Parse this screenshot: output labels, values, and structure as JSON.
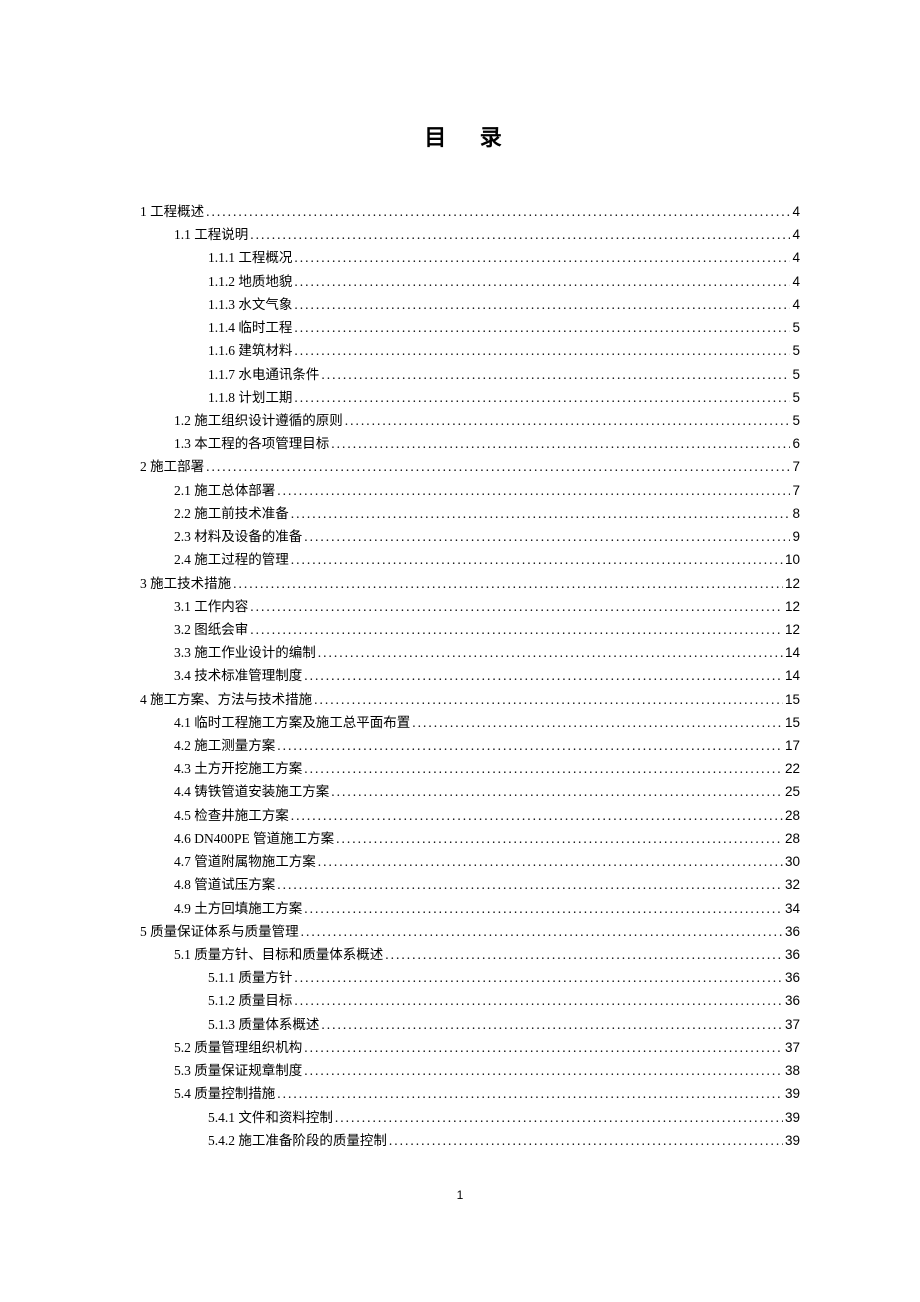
{
  "title": "目 录",
  "pageNumber": "1",
  "entries": [
    {
      "level": 1,
      "label": "1 工程概述",
      "page": "4"
    },
    {
      "level": 2,
      "label": "1.1 工程说明",
      "page": "4"
    },
    {
      "level": 3,
      "label": "1.1.1 工程概况",
      "page": "4"
    },
    {
      "level": 3,
      "label": "1.1.2 地质地貌",
      "page": "4"
    },
    {
      "level": 3,
      "label": "1.1.3 水文气象",
      "page": "4"
    },
    {
      "level": 3,
      "label": "1.1.4 临时工程",
      "page": "5"
    },
    {
      "level": 3,
      "label": "1.1.6 建筑材料",
      "page": "5"
    },
    {
      "level": 3,
      "label": "1.1.7 水电通讯条件",
      "page": "5"
    },
    {
      "level": 3,
      "label": "1.1.8 计划工期",
      "page": "5"
    },
    {
      "level": 2,
      "label": "1.2 施工组织设计遵循的原则",
      "page": "5"
    },
    {
      "level": 2,
      "label": "1.3 本工程的各项管理目标",
      "page": "6"
    },
    {
      "level": 1,
      "label": "2 施工部署",
      "page": "7"
    },
    {
      "level": 2,
      "label": "2.1 施工总体部署",
      "page": "7"
    },
    {
      "level": 2,
      "label": "2.2 施工前技术准备",
      "page": "8"
    },
    {
      "level": 2,
      "label": "2.3 材料及设备的准备",
      "page": "9"
    },
    {
      "level": 2,
      "label": "2.4 施工过程的管理",
      "page": "10"
    },
    {
      "level": 1,
      "label": "3 施工技术措施",
      "page": "12"
    },
    {
      "level": 2,
      "label": "3.1 工作内容",
      "page": "12"
    },
    {
      "level": 2,
      "label": "3.2 图纸会审",
      "page": "12"
    },
    {
      "level": 2,
      "label": "3.3 施工作业设计的编制",
      "page": "14"
    },
    {
      "level": 2,
      "label": "3.4 技术标准管理制度",
      "page": "14"
    },
    {
      "level": 1,
      "label": "4 施工方案、方法与技术措施",
      "page": "15"
    },
    {
      "level": 2,
      "label": "4.1 临时工程施工方案及施工总平面布置",
      "page": "15"
    },
    {
      "level": 2,
      "label": "4.2 施工测量方案",
      "page": "17"
    },
    {
      "level": 2,
      "label": "4.3 土方开挖施工方案",
      "page": "22"
    },
    {
      "level": 2,
      "label": "4.4 铸铁管道安装施工方案",
      "page": "25"
    },
    {
      "level": 2,
      "label": "4.5 检查井施工方案",
      "page": "28"
    },
    {
      "level": 2,
      "label": "4.6 DN400PE 管道施工方案",
      "page": "28"
    },
    {
      "level": 2,
      "label": "4.7 管道附属物施工方案",
      "page": "30"
    },
    {
      "level": 2,
      "label": "4.8 管道试压方案",
      "page": "32"
    },
    {
      "level": 2,
      "label": "4.9 土方回填施工方案",
      "page": "34"
    },
    {
      "level": 1,
      "label": "5 质量保证体系与质量管理",
      "page": "36"
    },
    {
      "level": 2,
      "label": "5.1 质量方针、目标和质量体系概述",
      "page": "36"
    },
    {
      "level": 3,
      "label": "5.1.1 质量方针",
      "page": "36"
    },
    {
      "level": 3,
      "label": "5.1.2 质量目标",
      "page": "36"
    },
    {
      "level": 3,
      "label": "5.1.3 质量体系概述",
      "page": "37"
    },
    {
      "level": 2,
      "label": "5.2 质量管理组织机构",
      "page": "37"
    },
    {
      "level": 2,
      "label": "5.3 质量保证规章制度",
      "page": "38"
    },
    {
      "level": 2,
      "label": "5.4 质量控制措施",
      "page": "39"
    },
    {
      "level": 3,
      "label": "5.4.1 文件和资料控制",
      "page": "39"
    },
    {
      "level": 3,
      "label": "5.4.2 施工准备阶段的质量控制",
      "page": "39"
    }
  ]
}
